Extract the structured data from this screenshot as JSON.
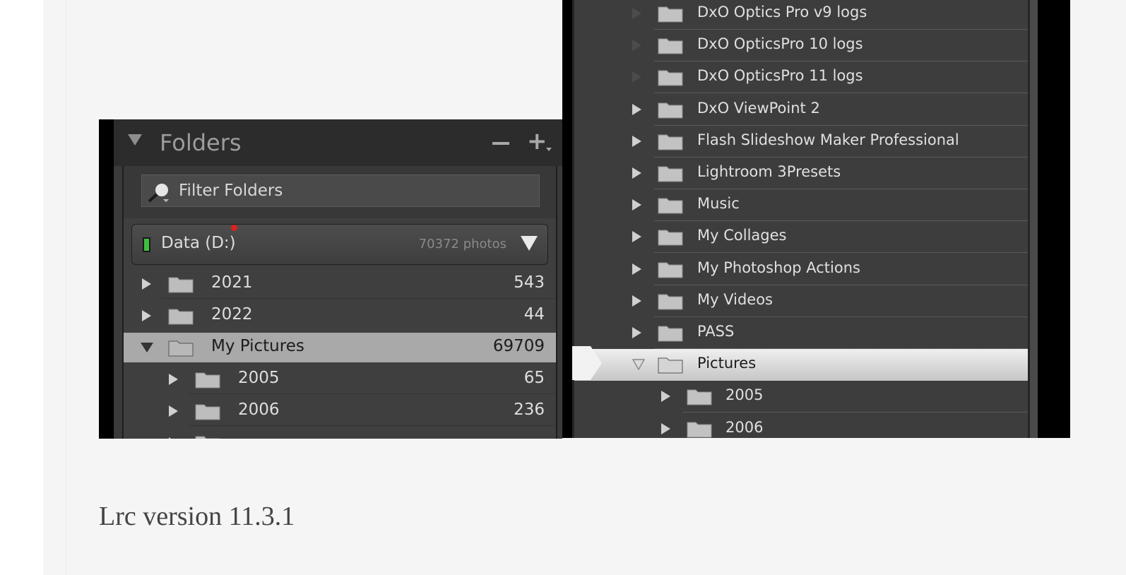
{
  "left_panel": {
    "title": "Folders",
    "minus_label": "−",
    "plus_label": "+",
    "filter_placeholder": "Filter Folders",
    "volume": {
      "name": "Data (D:)",
      "count": "70372 photos"
    },
    "rows": [
      {
        "name": "2021",
        "count": "543"
      },
      {
        "name": "2022",
        "count": "44"
      },
      {
        "name": "My Pictures",
        "count": "69709"
      },
      {
        "name": "2005",
        "count": "65"
      },
      {
        "name": "2006",
        "count": "236"
      }
    ]
  },
  "right_panel": {
    "rows": [
      {
        "name": "DxO Optics Pro v9 logs"
      },
      {
        "name": "DxO OpticsPro 10 logs"
      },
      {
        "name": "DxO OpticsPro 11 logs"
      },
      {
        "name": "DxO ViewPoint 2"
      },
      {
        "name": "Flash Slideshow Maker Professional"
      },
      {
        "name": "Lightroom 3Presets"
      },
      {
        "name": "Music"
      },
      {
        "name": "My Collages"
      },
      {
        "name": "My Photoshop Actions"
      },
      {
        "name": "My Videos"
      },
      {
        "name": "PASS"
      },
      {
        "name": "Pictures"
      },
      {
        "name": "2005"
      },
      {
        "name": "2006"
      }
    ]
  },
  "caption": "Lrc version 11.3.1",
  "colors": {
    "page_bg": "#f5f5f5",
    "panel_bg": "#3d3d3d",
    "selected_row": "#a9a9a9",
    "volume_indicator": "#3fbf3f",
    "red_dot": "#e02020"
  }
}
